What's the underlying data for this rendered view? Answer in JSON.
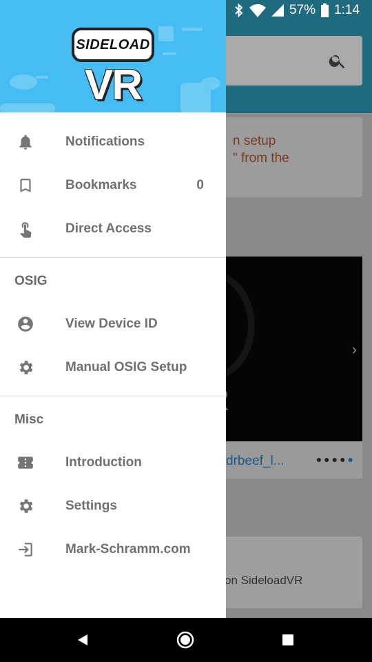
{
  "status_bar": {
    "battery_percent": "57%",
    "time": "1:14"
  },
  "background": {
    "card_text_line1": "n setup",
    "card_text_line2": "\" from the",
    "video_caption": "drbeef_l...",
    "bottom_card_text": "on SideloadVR"
  },
  "drawer": {
    "logo_top": "SIDELOAD",
    "logo_bottom": "VR",
    "items_top": [
      {
        "label": "Notifications",
        "icon": "bell-icon"
      },
      {
        "label": "Bookmarks",
        "icon": "bookmark-icon",
        "count": "0"
      },
      {
        "label": "Direct Access",
        "icon": "touch-icon"
      }
    ],
    "section_osig": {
      "title": "OSIG",
      "items": [
        {
          "label": "View Device ID",
          "icon": "account-circle-icon"
        },
        {
          "label": "Manual OSIG Setup",
          "icon": "gear-icon"
        }
      ]
    },
    "section_misc": {
      "title": "Misc",
      "items": [
        {
          "label": "Introduction",
          "icon": "ticket-icon"
        },
        {
          "label": "Settings",
          "icon": "gear-icon"
        },
        {
          "label": "Mark-Schramm.com",
          "icon": "login-icon"
        }
      ]
    }
  },
  "colors": {
    "header_blue": "#45bdf3",
    "text_gray": "#707070"
  }
}
